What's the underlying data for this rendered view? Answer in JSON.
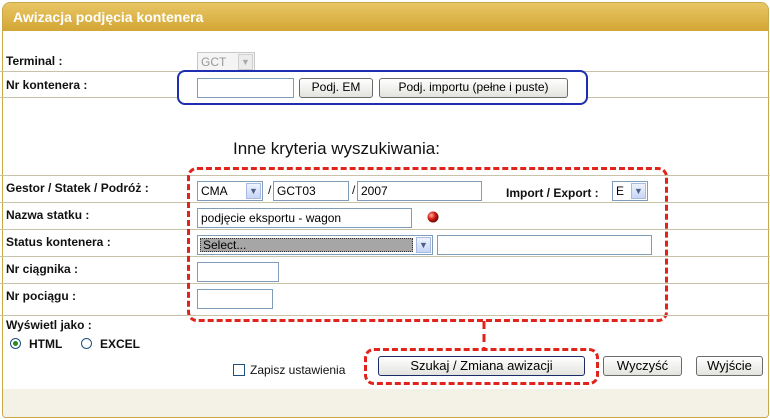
{
  "window": {
    "title": "Awizacja podjęcia kontenera"
  },
  "terminal": {
    "label": "Terminal :",
    "value": "GCT"
  },
  "container": {
    "label": "Nr kontenera :",
    "value": "",
    "btn_em": "Podj. EM",
    "btn_import": "Podj. importu (pełne i puste)"
  },
  "criteria_heading": "Inne kryteria wyszukiwania:",
  "gestor": {
    "label": "Gestor / Statek / Podróż :",
    "gestor_value": "CMA",
    "sep1": "/",
    "statek_value": "GCT03",
    "sep2": "/",
    "podroz_value": "2007"
  },
  "import_export": {
    "label": "Import / Export :",
    "value": "E"
  },
  "vessel_name": {
    "label": "Nazwa statku :",
    "value": "podjęcie eksportu - wagon"
  },
  "status": {
    "label": "Status kontenera :",
    "value": "Select...",
    "extra_value": ""
  },
  "tractor": {
    "label": "Nr ciągnika :",
    "value": ""
  },
  "train": {
    "label": "Nr pociągu :",
    "value": ""
  },
  "display": {
    "label": "Wyświetl jako :",
    "options": [
      {
        "label": "HTML",
        "selected": true
      },
      {
        "label": "EXCEL",
        "selected": false
      }
    ]
  },
  "footer": {
    "save_settings": "Zapisz ustawienia",
    "search_btn": "Szukaj / Zmiana awizacji",
    "clear_btn": "Wyczyść",
    "exit_btn": "Wyjście"
  },
  "colors": {
    "title_bar": "#d9ad40",
    "annotation_red": "#e0231b",
    "annotation_blue": "#1d2fb0"
  }
}
